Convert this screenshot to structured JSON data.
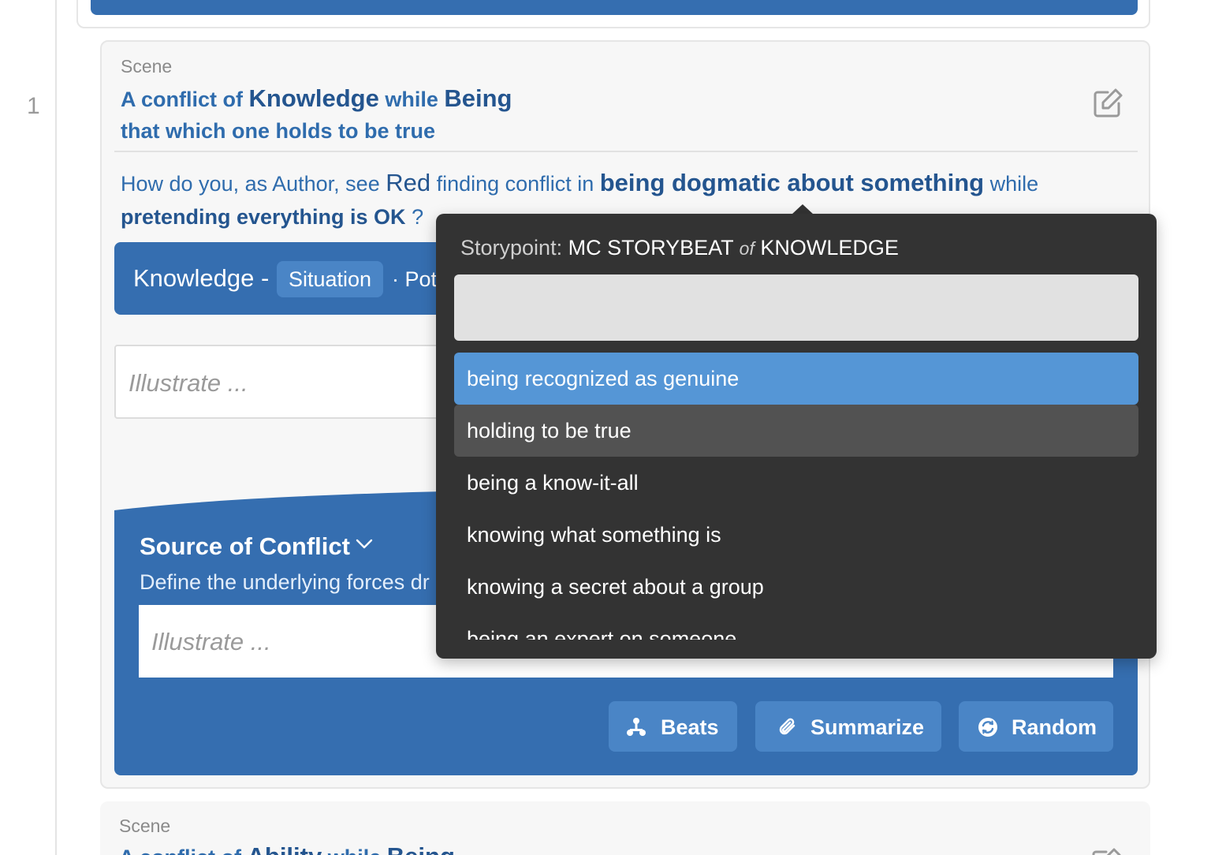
{
  "gutter": {
    "line_number": "1"
  },
  "scene": {
    "label": "Scene",
    "title": {
      "p1": "A conflict of ",
      "w1": "Knowledge",
      "p2": " while ",
      "w2": "Being",
      "line2": "that which one holds to be true"
    },
    "question": {
      "p1": "How do you, as Author, see ",
      "name": "Red",
      "p2": " finding conflict in ",
      "s1": "being dogmatic about something",
      "p3": " while ",
      "s2": "pretending everything is OK",
      "p4": " ?"
    },
    "storybeat": {
      "title": "Knowledge -",
      "chip": "Situation",
      "extra": "· Pot"
    },
    "illustrate_placeholder": "Illustrate ...",
    "source_of_conflict": {
      "title": "Source of Conflict",
      "description": "Define the underlying forces dr",
      "illustrate_placeholder": "Illustrate ..."
    },
    "buttons": {
      "beats": "Beats",
      "summarize": "Summarize",
      "random": "Random"
    }
  },
  "scene2": {
    "label": "Scene",
    "title_p1": "A conflict of ",
    "title_w1": "Ability",
    "title_p2": " while ",
    "title_w2": "Being"
  },
  "popover": {
    "header": {
      "label": "Storypoint: ",
      "storybeat": "MC STORYBEAT",
      "of": "of",
      "domain": "KNOWLEDGE"
    },
    "search_value": "",
    "items": [
      "being recognized as genuine",
      "holding to be true",
      "being a know-it-all",
      "knowing what something is",
      "knowing a secret about a group",
      "being an expert on someone"
    ],
    "selected_index": 0,
    "hovered_index": 1
  },
  "colors": {
    "primary_blue": "#356eb0",
    "button_blue": "#4a85c6",
    "text_blue": "#2f6cad",
    "popover_bg": "#333333",
    "selected_item": "#5596d6",
    "hovered_item": "#525252"
  }
}
